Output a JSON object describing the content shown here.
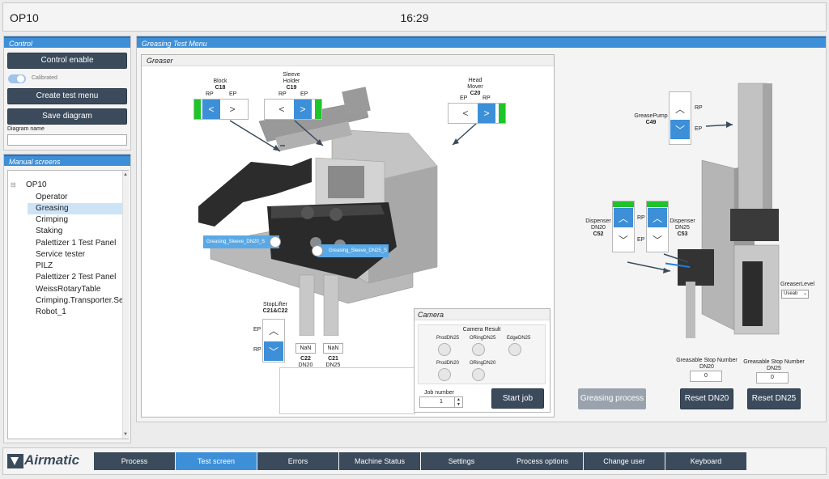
{
  "header": {
    "station": "OP10",
    "clock": "16:29"
  },
  "control": {
    "title": "Control",
    "enable_label": "Control enable",
    "calibrated_label": "Calibrated",
    "create_test_menu_label": "Create test menu",
    "save_diagram_label": "Save diagram",
    "diagram_name_label": "Diagram name",
    "diagram_name_value": ""
  },
  "manual": {
    "title": "Manual screens",
    "root": "OP10",
    "items": [
      "Operator",
      "Greasing",
      "Crimping",
      "Staking",
      "Palettizer 1 Test Panel",
      "Service tester",
      "PILZ",
      "Palettizer 2 Test Panel",
      "WeissRotaryTable",
      "Crimping.Transporter.Ser",
      "Robot_1"
    ],
    "selected": "Greasing"
  },
  "main": {
    "title": "Greasing Test Menu",
    "greaser_title": "Greaser",
    "block": {
      "name": "Block",
      "code": "C18",
      "left": "RP",
      "right": "EP"
    },
    "sleeve": {
      "name1": "Sleeve",
      "name2": "Holder",
      "code": "C19",
      "left": "RP",
      "right": "EP"
    },
    "head": {
      "name1": "Head",
      "name2": "Mover",
      "code": "C20",
      "left": "EP",
      "right": "RP"
    },
    "stoplifter": {
      "name": "StopLifter",
      "code": "C21&C22",
      "top": "EP",
      "bottom": "RP"
    },
    "sensor1": "Greasing_Sleeve_DN20_S",
    "sensor2": "Greasing_Sleeve_DN25_S",
    "nan1": "NaN",
    "c22": "C22",
    "dn20": "DN20",
    "nan2": "NaN",
    "c21": "C21",
    "dn25": "DN25",
    "camera": {
      "title": "Camera",
      "result_title": "Camera Result",
      "labels": [
        "ProdDN25",
        "ORingDN25",
        "EdgeDN25",
        "ProdDN20",
        "ORingDN20"
      ],
      "job_number_label": "Job number",
      "job_number_value": "1",
      "start_job_label": "Start job"
    },
    "greasepump": {
      "name": "GreasePump",
      "code": "C49",
      "top": "RP",
      "bottom": "EP"
    },
    "dispenser20": {
      "name": "Dispenser",
      "dn": "DN20",
      "code": "C52",
      "top": "RP",
      "bottom": "EP"
    },
    "dispenser25": {
      "name": "Dispenser",
      "dn": "DN25",
      "code": "C53"
    },
    "greaser_level": {
      "label": "GreaserLevel",
      "value": "Useab"
    },
    "stop_dn20": {
      "label": "Greasable Stop Number",
      "dn": "DN20",
      "value": "0"
    },
    "stop_dn25": {
      "label": "Greasable Stop Number",
      "dn": "DN25",
      "value": "0"
    },
    "greasing_process_label": "Greasing process",
    "reset_dn20_label": "Reset DN20",
    "reset_dn25_label": "Reset DN25"
  },
  "footer": {
    "logo": "Airmatic",
    "tabs": [
      "Process",
      "Test screen",
      "Errors",
      "Machine Status",
      "Settings",
      "Process options",
      "Change user",
      "Keyboard"
    ],
    "active_tab": "Test screen"
  },
  "colors": {
    "accent": "#3d8fd8",
    "dark_button": "#3b4b5c",
    "active_green": "#1fc42a"
  }
}
